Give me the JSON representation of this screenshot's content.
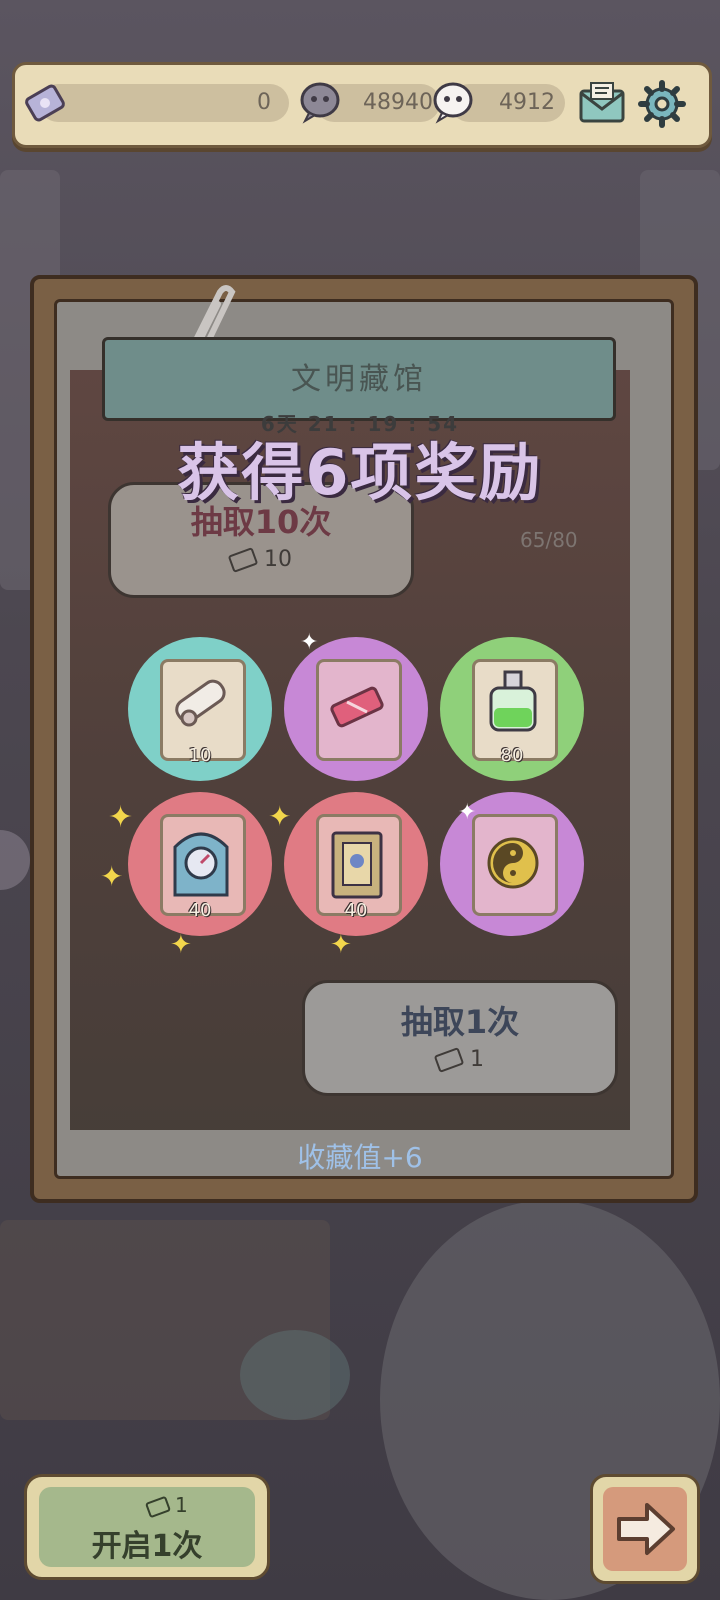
{
  "topbar": {
    "ticket_count": "0",
    "currency_a": "48940",
    "currency_b": "4912"
  },
  "gacha": {
    "title": "文明藏馆",
    "timer": "6天 21 : 19 : 54",
    "progress": "65/80",
    "pull10": {
      "label": "抽取10次",
      "cost": "10"
    },
    "pull1": {
      "label": "抽取1次",
      "cost": "1"
    }
  },
  "rewards": {
    "title": "获得6项奖励",
    "collection": "收藏值+6",
    "items": [
      {
        "icon": "scroll-icon",
        "count": "10",
        "bg": "#7fd0c8"
      },
      {
        "icon": "ticket-icon",
        "count": "",
        "bg": "#c788d6"
      },
      {
        "icon": "potion-bottle-icon",
        "count": "80",
        "bg": "#8fd07a"
      },
      {
        "icon": "clock-relic-icon",
        "count": "40",
        "bg": "#e07b84"
      },
      {
        "icon": "book-relic-icon",
        "count": "40",
        "bg": "#e07b84"
      },
      {
        "icon": "yin-yang-coin-icon",
        "count": "",
        "bg": "#c788d6"
      }
    ]
  },
  "footer": {
    "open_label": "开启1次",
    "open_cost": "1"
  },
  "colors": {
    "panel": "#e9dcb8",
    "frame": "#7a6045",
    "accent_text": "#9fc1e8"
  }
}
